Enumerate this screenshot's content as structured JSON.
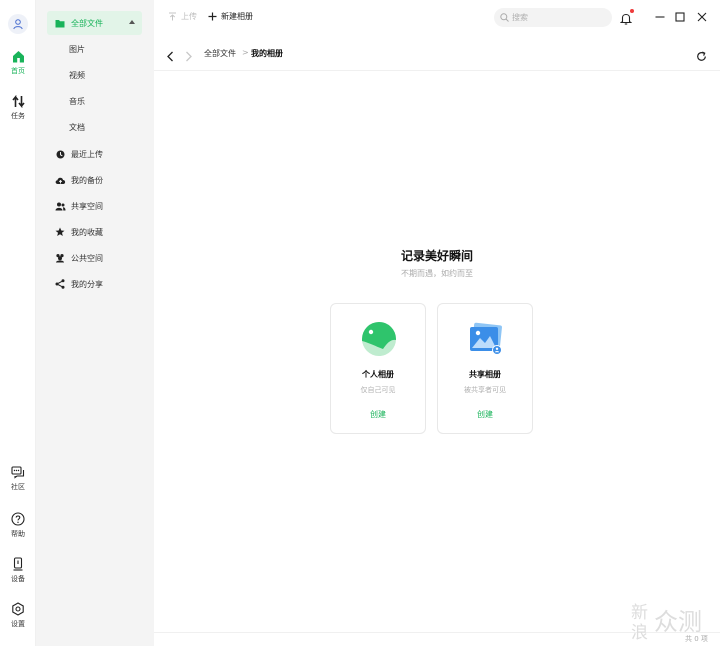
{
  "rail": {
    "home": "首页",
    "tasks": "任务",
    "community": "社区",
    "help": "帮助",
    "devices": "设备",
    "settings": "设置"
  },
  "sidebar": {
    "all_files": "全部文件",
    "sub": [
      "图片",
      "视频",
      "音乐",
      "文档"
    ],
    "items": [
      "最近上传",
      "我的备份",
      "共享空间",
      "我的收藏",
      "公共空间",
      "我的分享"
    ]
  },
  "toolbar": {
    "upload": "上传",
    "new_album": "新建相册",
    "search_placeholder": "搜索"
  },
  "breadcrumb": {
    "root": "全部文件",
    "sep": ">",
    "current": "我的相册"
  },
  "main": {
    "title": "记录美好瞬间",
    "subtitle": "不期而遇，如约而至",
    "cards": [
      {
        "name": "个人相册",
        "desc": "仅自己可见",
        "action": "创建"
      },
      {
        "name": "共享相册",
        "desc": "被共享者可见",
        "action": "创建"
      }
    ]
  },
  "status": {
    "count": "共 0 项"
  },
  "watermark": {
    "line1": "新",
    "line2": "浪",
    "text": "众测"
  },
  "colors": {
    "accent": "#19b35a",
    "sidebar_bg": "#f4f4f4",
    "badge": "#ee3b3b"
  }
}
